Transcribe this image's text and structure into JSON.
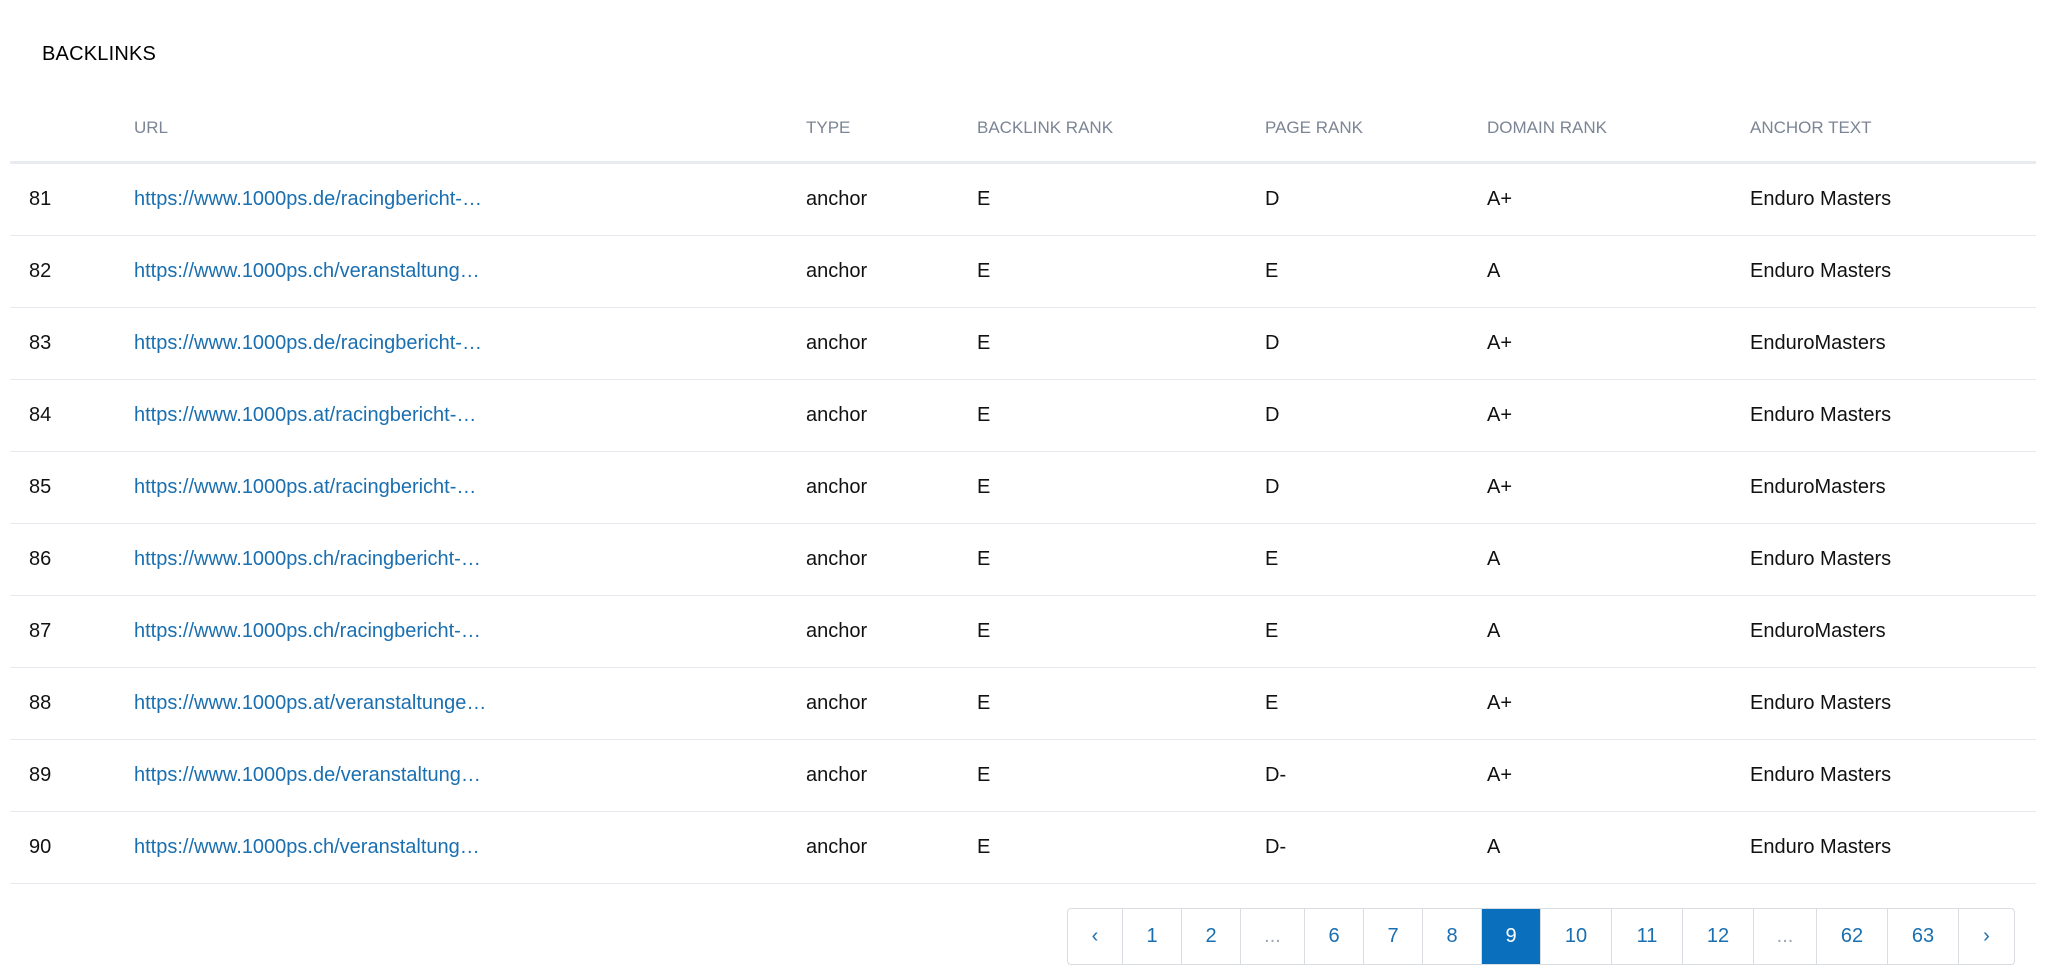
{
  "section": {
    "title": "BACKLINKS"
  },
  "table": {
    "columns": [
      "",
      "URL",
      "TYPE",
      "BACKLINK RANK",
      "PAGE RANK",
      "DOMAIN RANK",
      "ANCHOR TEXT"
    ],
    "rows": [
      {
        "num": "81",
        "url": "https://www.1000ps.de/racingbericht-…",
        "type": "anchor",
        "backlink_rank": "E",
        "page_rank": "D",
        "domain_rank": "A+",
        "anchor_text": "Enduro Masters"
      },
      {
        "num": "82",
        "url": "https://www.1000ps.ch/veranstaltung…",
        "type": "anchor",
        "backlink_rank": "E",
        "page_rank": "E",
        "domain_rank": "A",
        "anchor_text": "Enduro Masters"
      },
      {
        "num": "83",
        "url": "https://www.1000ps.de/racingbericht-…",
        "type": "anchor",
        "backlink_rank": "E",
        "page_rank": "D",
        "domain_rank": "A+",
        "anchor_text": "EnduroMasters"
      },
      {
        "num": "84",
        "url": "https://www.1000ps.at/racingbericht-…",
        "type": "anchor",
        "backlink_rank": "E",
        "page_rank": "D",
        "domain_rank": "A+",
        "anchor_text": "Enduro Masters"
      },
      {
        "num": "85",
        "url": "https://www.1000ps.at/racingbericht-…",
        "type": "anchor",
        "backlink_rank": "E",
        "page_rank": "D",
        "domain_rank": "A+",
        "anchor_text": "EnduroMasters"
      },
      {
        "num": "86",
        "url": "https://www.1000ps.ch/racingbericht-…",
        "type": "anchor",
        "backlink_rank": "E",
        "page_rank": "E",
        "domain_rank": "A",
        "anchor_text": "Enduro Masters"
      },
      {
        "num": "87",
        "url": "https://www.1000ps.ch/racingbericht-…",
        "type": "anchor",
        "backlink_rank": "E",
        "page_rank": "E",
        "domain_rank": "A",
        "anchor_text": "EnduroMasters"
      },
      {
        "num": "88",
        "url": "https://www.1000ps.at/veranstaltunge…",
        "type": "anchor",
        "backlink_rank": "E",
        "page_rank": "E",
        "domain_rank": "A+",
        "anchor_text": "Enduro Masters"
      },
      {
        "num": "89",
        "url": "https://www.1000ps.de/veranstaltung…",
        "type": "anchor",
        "backlink_rank": "E",
        "page_rank": "D-",
        "domain_rank": "A+",
        "anchor_text": "Enduro Masters"
      },
      {
        "num": "90",
        "url": "https://www.1000ps.ch/veranstaltung…",
        "type": "anchor",
        "backlink_rank": "E",
        "page_rank": "D-",
        "domain_rank": "A",
        "anchor_text": "Enduro Masters"
      }
    ]
  },
  "pagination": {
    "prev": "‹",
    "next": "›",
    "pages": [
      "1",
      "2",
      "...",
      "6",
      "7",
      "8",
      "9",
      "10",
      "11",
      "12",
      "...",
      "62",
      "63"
    ],
    "current": "9"
  },
  "colors": {
    "link": "#1a6fb0",
    "active_page_bg": "#0a6fbd",
    "header_text": "#7b8594"
  }
}
